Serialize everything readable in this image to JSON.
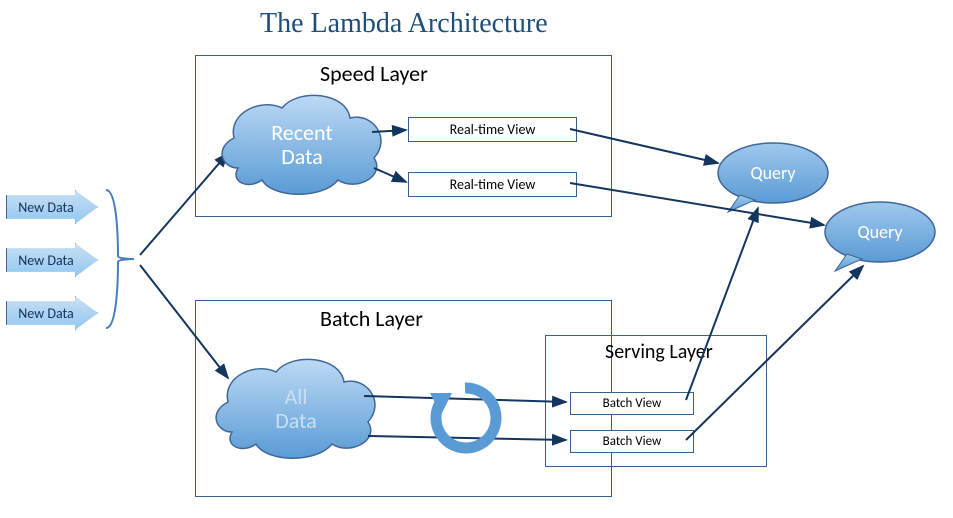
{
  "title": "The Lambda Architecture",
  "newData": [
    "New Data",
    "New Data",
    "New Data"
  ],
  "speedLayer": {
    "label": "Speed Layer",
    "recentData": "Recent Data",
    "views": [
      "Real-time View",
      "Real-time View"
    ]
  },
  "batchLayer": {
    "label": "Batch Layer",
    "allData": "All Data"
  },
  "servingLayer": {
    "label": "Serving Layer",
    "views": [
      "Batch View",
      "Batch View"
    ]
  },
  "queries": [
    "Query",
    "Query"
  ]
}
